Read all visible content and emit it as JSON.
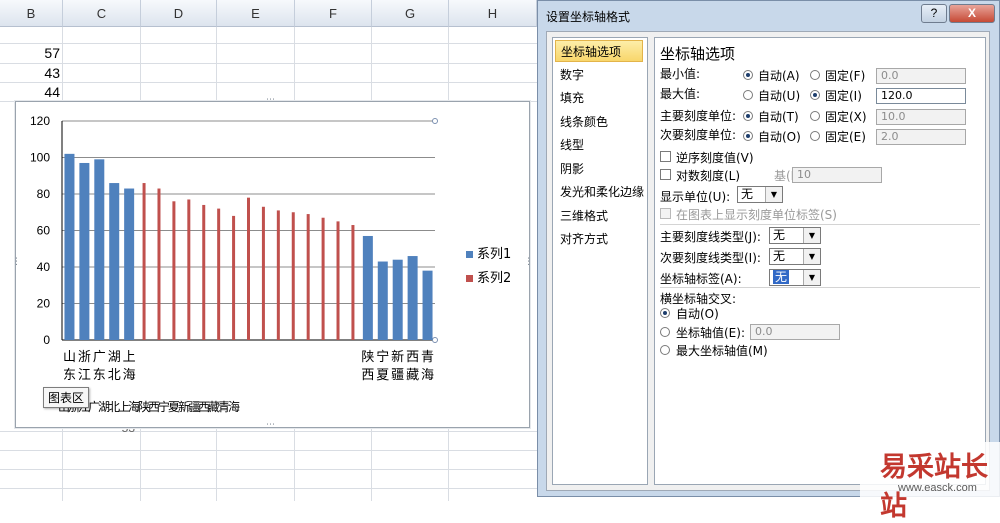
{
  "spreadsheet": {
    "columns": [
      "B",
      "C",
      "D",
      "E",
      "F",
      "G",
      "H"
    ],
    "visible_values": [
      "57",
      "43",
      "44"
    ],
    "hidden_partial_value": "53"
  },
  "chart": {
    "area_tooltip": "图表区",
    "overlapped_axis_text_1": "山浙江广湖北上海",
    "overlapped_axis_text_2": "陕西宁夏新疆西藏青海"
  },
  "chart_data": {
    "type": "bar",
    "title": "",
    "ylim": [
      0,
      120
    ],
    "yticks": [
      "0",
      "20",
      "40",
      "60",
      "80",
      "100",
      "120"
    ],
    "grid": true,
    "legend_position": "right",
    "x_labels_shown": [
      {
        "index": 0,
        "text": "山东"
      },
      {
        "index": 1,
        "text": "浙江"
      },
      {
        "index": 2,
        "text": "广东"
      },
      {
        "index": 3,
        "text": "湖北"
      },
      {
        "index": 4,
        "text": "上海"
      },
      {
        "index": 20,
        "text": "陕西"
      },
      {
        "index": 21,
        "text": "宁夏"
      },
      {
        "index": 22,
        "text": "新疆"
      },
      {
        "index": 23,
        "text": "西藏"
      },
      {
        "index": 24,
        "text": "青海"
      }
    ],
    "series": [
      {
        "name": "系列1",
        "color": "#4f81bd",
        "values": [
          102,
          97,
          99,
          86,
          83,
          null,
          null,
          null,
          null,
          null,
          null,
          null,
          null,
          null,
          null,
          null,
          null,
          null,
          null,
          null,
          57,
          43,
          44,
          46,
          38
        ]
      },
      {
        "name": "系列2",
        "color": "#c0504d",
        "values": [
          null,
          null,
          null,
          null,
          null,
          86,
          83,
          76,
          77,
          74,
          72,
          68,
          78,
          73,
          71,
          70,
          69,
          67,
          65,
          63,
          null,
          null,
          null,
          null,
          null
        ]
      }
    ]
  },
  "dialog": {
    "title": "设置坐标轴格式",
    "help_label": "?",
    "close_label": "X",
    "nav_items": [
      "坐标轴选项",
      "数字",
      "填充",
      "线条颜色",
      "线型",
      "阴影",
      "发光和柔化边缘",
      "三维格式",
      "对齐方式"
    ],
    "selected_nav": 0,
    "panel_title": "坐标轴选项",
    "min": {
      "label": "最小值:",
      "auto": "自动(A)",
      "fixed": "固定(F)",
      "value": "0.0"
    },
    "max": {
      "label": "最大值:",
      "auto": "自动(U)",
      "fixed": "固定(I)",
      "value": "120.0"
    },
    "major_unit": {
      "label": "主要刻度单位:",
      "auto": "自动(T)",
      "fixed": "固定(X)",
      "value": "10.0"
    },
    "minor_unit": {
      "label": "次要刻度单位:",
      "auto": "自动(O)",
      "fixed": "固定(E)",
      "value": "2.0"
    },
    "reverse_label": "逆序刻度值(V)",
    "log_label": "对数刻度(L)",
    "log_base_label": "基(B):",
    "log_base_value": "10",
    "display_unit_label": "显示单位(U):",
    "display_unit_value": "无",
    "show_unit_label": "在图表上显示刻度单位标签(S)",
    "major_tick_type_label": "主要刻度线类型(J):",
    "major_tick_type_value": "无",
    "minor_tick_type_label": "次要刻度线类型(I):",
    "minor_tick_type_value": "无",
    "axis_label_label": "坐标轴标签(A):",
    "axis_label_value": "无",
    "crosses_title": "横坐标轴交叉:",
    "crosses_auto": "自动(O)",
    "crosses_value_label": "坐标轴值(E):",
    "crosses_value": "0.0",
    "crosses_max": "最大坐标轴值(M)"
  },
  "watermark": {
    "brand": "易采站长站",
    "site": "www.easck.com"
  }
}
